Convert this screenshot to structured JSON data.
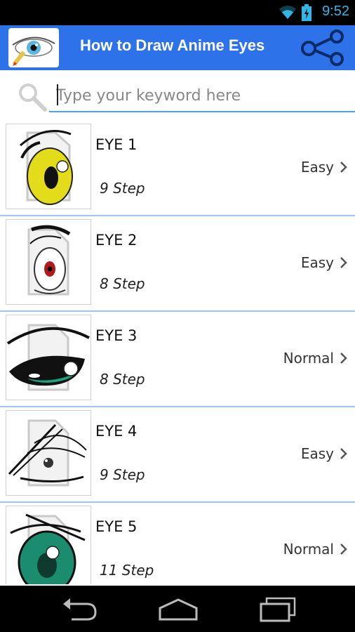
{
  "status_bar": {
    "time": "9:52"
  },
  "app": {
    "title": "How to Draw Anime Eyes"
  },
  "search": {
    "placeholder": "Type your keyword here"
  },
  "items": [
    {
      "title": "EYE 1",
      "steps": "9 Step",
      "level": "Easy"
    },
    {
      "title": "EYE 2",
      "steps": "8 Step",
      "level": "Easy"
    },
    {
      "title": "EYE 3",
      "steps": "8 Step",
      "level": "Normal"
    },
    {
      "title": "EYE 4",
      "steps": "9 Step",
      "level": "Easy"
    },
    {
      "title": "EYE 5",
      "steps": "11 Step",
      "level": "Normal"
    }
  ],
  "icons": {
    "wifi": "wifi-icon",
    "battery": "battery-icon",
    "share": "share-icon",
    "search": "search-icon",
    "back": "back-icon",
    "home": "home-icon",
    "recents": "recents-icon"
  },
  "colors": {
    "action_bar": "#2e72ea",
    "accent": "#33b5e5",
    "divider": "#9ac6ef"
  }
}
